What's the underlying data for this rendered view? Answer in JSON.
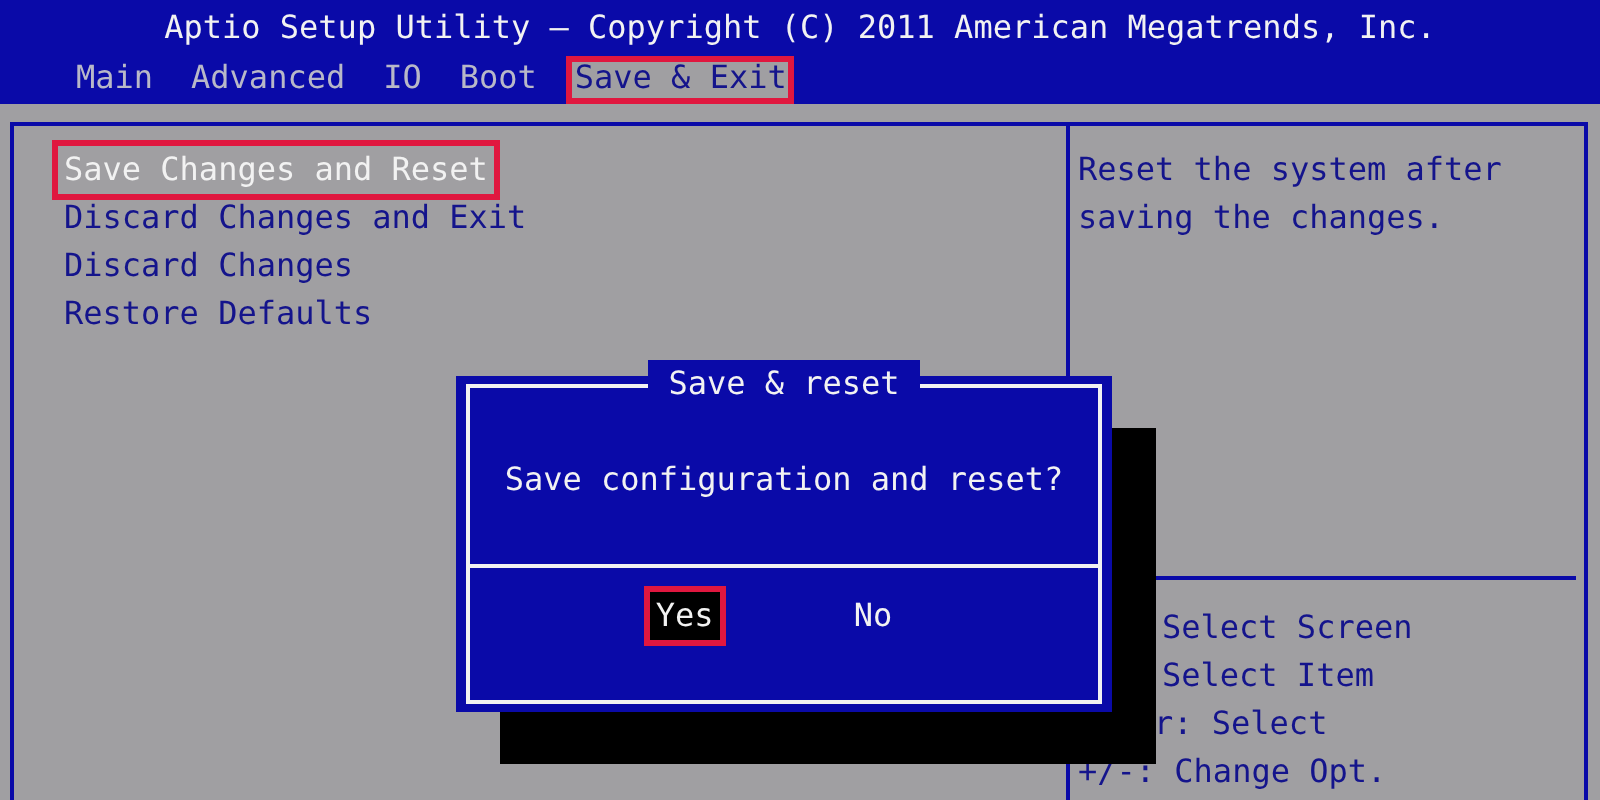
{
  "header": {
    "title": "Aptio Setup Utility – Copyright (C) 2011 American Megatrends, Inc."
  },
  "tabs": [
    {
      "label": "Main",
      "selected": false,
      "highlighted": false
    },
    {
      "label": "Advanced",
      "selected": false,
      "highlighted": false
    },
    {
      "label": "IO",
      "selected": false,
      "highlighted": false
    },
    {
      "label": "Boot",
      "selected": false,
      "highlighted": false
    },
    {
      "label": "Save & Exit",
      "selected": true,
      "highlighted": true
    }
  ],
  "menu": [
    {
      "label": "Save Changes and Reset",
      "selected": true,
      "highlighted": true
    },
    {
      "label": "Discard Changes and Exit",
      "selected": false,
      "highlighted": false
    },
    {
      "label": "Discard Changes",
      "selected": false,
      "highlighted": false
    },
    {
      "label": "Restore Defaults",
      "selected": false,
      "highlighted": false
    }
  ],
  "help": {
    "text": "Reset the system after saving the changes.",
    "keys": [
      "Select Screen",
      "Select Item",
      "r: Select",
      "+/-: Change Opt."
    ]
  },
  "dialog": {
    "title": "Save & reset",
    "message": "Save configuration and reset?",
    "buttons": [
      {
        "label": "Yes",
        "selected": true,
        "highlighted": true
      },
      {
        "label": "No",
        "selected": false,
        "highlighted": false
      }
    ]
  }
}
